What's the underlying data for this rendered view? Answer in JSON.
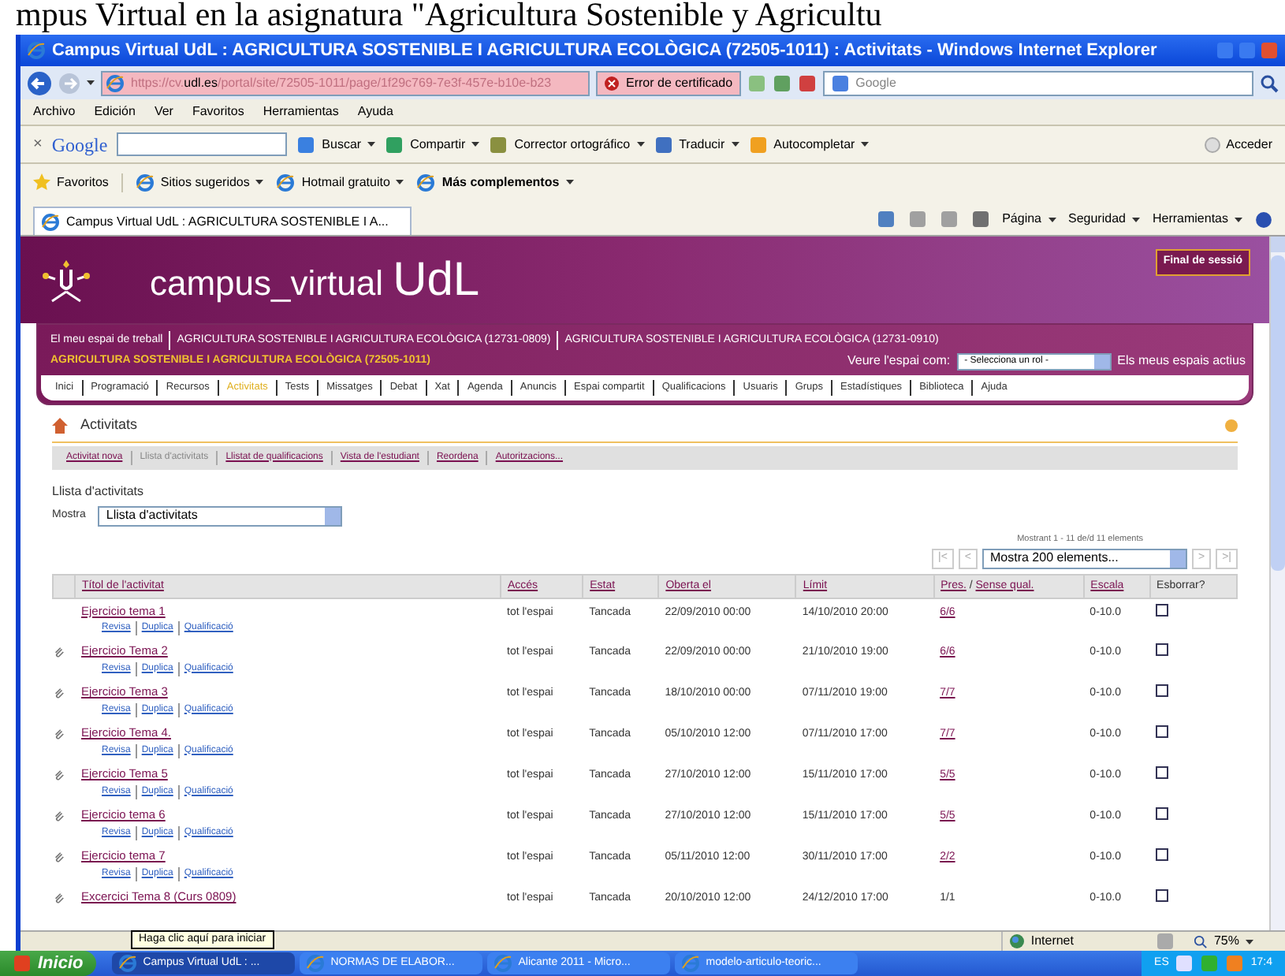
{
  "caption": "mpus Virtual en la asignatura \"Agricultura Sostenible y Agricultu",
  "window": {
    "title": "Campus Virtual UdL : AGRICULTURA SOSTENIBLE I AGRICULTURA ECOLÒGICA (72505-1011) : Activitats - Windows Internet Explorer"
  },
  "address": {
    "url_prefix": "https://cv.",
    "url_host": "udl.es",
    "url_path": "/portal/site/72505-1011/page/1f29c769-7e3f-457e-b10e-b23",
    "cert_error": "Error de certificado",
    "search_placeholder": "Google"
  },
  "menu": [
    "Archivo",
    "Edición",
    "Ver",
    "Favoritos",
    "Herramientas",
    "Ayuda"
  ],
  "google_toolbar": {
    "close": "×",
    "logo": "Google",
    "items": [
      "Buscar",
      "Compartir",
      "Corrector ortográfico",
      "Traducir",
      "Autocompletar"
    ],
    "sign_in": "Acceder"
  },
  "favorites_bar": {
    "label": "Favoritos",
    "items": [
      {
        "label": "Sitios sugeridos",
        "bold": false
      },
      {
        "label": "Hotmail gratuito",
        "bold": false
      },
      {
        "label": "Más complementos",
        "bold": true
      }
    ]
  },
  "tab": {
    "title": "Campus Virtual UdL : AGRICULTURA SOSTENIBLE I A..."
  },
  "command_bar": [
    "Página",
    "Seguridad",
    "Herramientas"
  ],
  "site": {
    "logo_text": "campus_virtual",
    "logo_brand": "UdL",
    "logout": "Final de sessió",
    "workspaces": [
      {
        "label": "El meu espai de treball",
        "selected": false
      },
      {
        "label": "AGRICULTURA SOSTENIBLE I AGRICULTURA ECOLÒGICA (12731-0809)",
        "selected": false
      },
      {
        "label": "AGRICULTURA SOSTENIBLE I AGRICULTURA ECOLÒGICA (12731-0910)",
        "selected": false
      },
      {
        "label": "AGRICULTURA SOSTENIBLE I AGRICULTURA ECOLÒGICA (72505-1011)",
        "selected": true
      }
    ],
    "view_as_label": "Veure l'espai com:",
    "role_select": "- Selecciona un rol -",
    "my_spaces": "Els meus espais actius",
    "nav": [
      {
        "label": "Inici",
        "selected": false
      },
      {
        "label": "Programació",
        "selected": false
      },
      {
        "label": "Recursos",
        "selected": false
      },
      {
        "label": "Activitats",
        "selected": true
      },
      {
        "label": "Tests",
        "selected": false
      },
      {
        "label": "Missatges",
        "selected": false
      },
      {
        "label": "Debat",
        "selected": false
      },
      {
        "label": "Xat",
        "selected": false
      },
      {
        "label": "Agenda",
        "selected": false
      },
      {
        "label": "Anuncis",
        "selected": false
      },
      {
        "label": "Espai compartit",
        "selected": false
      },
      {
        "label": "Qualificacions",
        "selected": false
      },
      {
        "label": "Usuaris",
        "selected": false
      },
      {
        "label": "Grups",
        "selected": false
      },
      {
        "label": "Estadístiques",
        "selected": false
      },
      {
        "label": "Biblioteca",
        "selected": false
      },
      {
        "label": "Ajuda",
        "selected": false
      }
    ]
  },
  "activities": {
    "title": "Activitats",
    "sub_links": [
      {
        "label": "Activitat nova",
        "selected": false
      },
      {
        "label": "Llista d'activitats",
        "selected": true
      },
      {
        "label": "Llistat de qualificacions",
        "selected": false
      },
      {
        "label": "Vista de l'estudiant",
        "selected": false
      },
      {
        "label": "Reordena",
        "selected": false
      },
      {
        "label": "Autoritzacions...",
        "selected": false
      }
    ],
    "list_title": "Llista d'activitats",
    "show_label": "Mostra",
    "show_select": "Llista d'activitats",
    "paging_info": "Mostrant 1 - 11 de/d 11 elements",
    "paging_select": "Mostra 200 elements...",
    "paging_first": "|<",
    "paging_prev": "<",
    "paging_next": ">",
    "paging_last": ">|"
  },
  "table": {
    "columns": [
      {
        "label": "Títol de l'activitat",
        "link": true
      },
      {
        "label": "Accés",
        "link": true
      },
      {
        "label": "Estat",
        "link": true
      },
      {
        "label": "Oberta el",
        "link": true
      },
      {
        "label": "Límit",
        "link": true
      },
      {
        "label": "Pres.",
        "link": true,
        "separator": "/",
        "second_label": "Sense qual."
      },
      {
        "label": "Escala",
        "link": true
      },
      {
        "label": "Esborrar?",
        "link": false
      }
    ],
    "rows": [
      {
        "title": "Ejercicio tema 1",
        "attachment": false,
        "access": "tot l'espai",
        "state": "Tancada",
        "opened": "22/09/2010 00:00",
        "limit": "14/10/2010 20:00",
        "submitted": "6/6",
        "submitted_link": true,
        "scale": "0-10.0",
        "delete_checked": false,
        "actions": [
          "Revisa",
          "Duplica",
          "Qualificació"
        ]
      },
      {
        "title": "Ejercicio Tema 2",
        "attachment": true,
        "access": "tot l'espai",
        "state": "Tancada",
        "opened": "22/09/2010 00:00",
        "limit": "21/10/2010 19:00",
        "submitted": "6/6",
        "submitted_link": true,
        "scale": "0-10.0",
        "delete_checked": false,
        "actions": [
          "Revisa",
          "Duplica",
          "Qualificació"
        ]
      },
      {
        "title": "Ejercicio Tema 3",
        "attachment": true,
        "access": "tot l'espai",
        "state": "Tancada",
        "opened": "18/10/2010 00:00",
        "limit": "07/11/2010 19:00",
        "submitted": "7/7",
        "submitted_link": true,
        "scale": "0-10.0",
        "delete_checked": false,
        "actions": [
          "Revisa",
          "Duplica",
          "Qualificació"
        ]
      },
      {
        "title": "Ejercicio Tema 4.",
        "attachment": true,
        "access": "tot l'espai",
        "state": "Tancada",
        "opened": "05/10/2010 12:00",
        "limit": "07/11/2010 17:00",
        "submitted": "7/7",
        "submitted_link": true,
        "scale": "0-10.0",
        "delete_checked": false,
        "actions": [
          "Revisa",
          "Duplica",
          "Qualificació"
        ]
      },
      {
        "title": "Ejercicio Tema 5",
        "attachment": true,
        "access": "tot l'espai",
        "state": "Tancada",
        "opened": "27/10/2010 12:00",
        "limit": "15/11/2010 17:00",
        "submitted": "5/5",
        "submitted_link": true,
        "scale": "0-10.0",
        "delete_checked": false,
        "actions": [
          "Revisa",
          "Duplica",
          "Qualificació"
        ]
      },
      {
        "title": "Ejercicio tema 6",
        "attachment": true,
        "access": "tot l'espai",
        "state": "Tancada",
        "opened": "27/10/2010 12:00",
        "limit": "15/11/2010 17:00",
        "submitted": "5/5",
        "submitted_link": true,
        "scale": "0-10.0",
        "delete_checked": false,
        "actions": [
          "Revisa",
          "Duplica",
          "Qualificació"
        ]
      },
      {
        "title": "Ejercicio tema 7",
        "attachment": true,
        "access": "tot l'espai",
        "state": "Tancada",
        "opened": "05/11/2010 12:00",
        "limit": "30/11/2010 17:00",
        "submitted": "2/2",
        "submitted_link": true,
        "scale": "0-10.0",
        "delete_checked": false,
        "actions": [
          "Revisa",
          "Duplica",
          "Qualificació"
        ]
      },
      {
        "title": "Excercici Tema 8 (Curs 0809)",
        "attachment": true,
        "access": "tot l'espai",
        "state": "Tancada",
        "opened": "20/10/2010 12:00",
        "limit": "24/12/2010 17:00",
        "submitted": "1/1",
        "submitted_link": false,
        "scale": "0-10.0",
        "delete_checked": false
      }
    ]
  },
  "status_bar": {
    "zone": "Internet",
    "zoom": "75%"
  },
  "tooltip": "Haga clic aquí para iniciar",
  "taskbar": {
    "start": "Inicio",
    "tasks": [
      {
        "label": "Campus Virtual UdL : ...",
        "selected": true
      },
      {
        "label": "NORMAS DE ELABOR...",
        "selected": false
      },
      {
        "label": "Alicante 2011 - Micro...",
        "selected": false
      },
      {
        "label": "modelo-articulo-teoric...",
        "selected": false
      }
    ],
    "language": "ES",
    "clock": "17:4"
  }
}
